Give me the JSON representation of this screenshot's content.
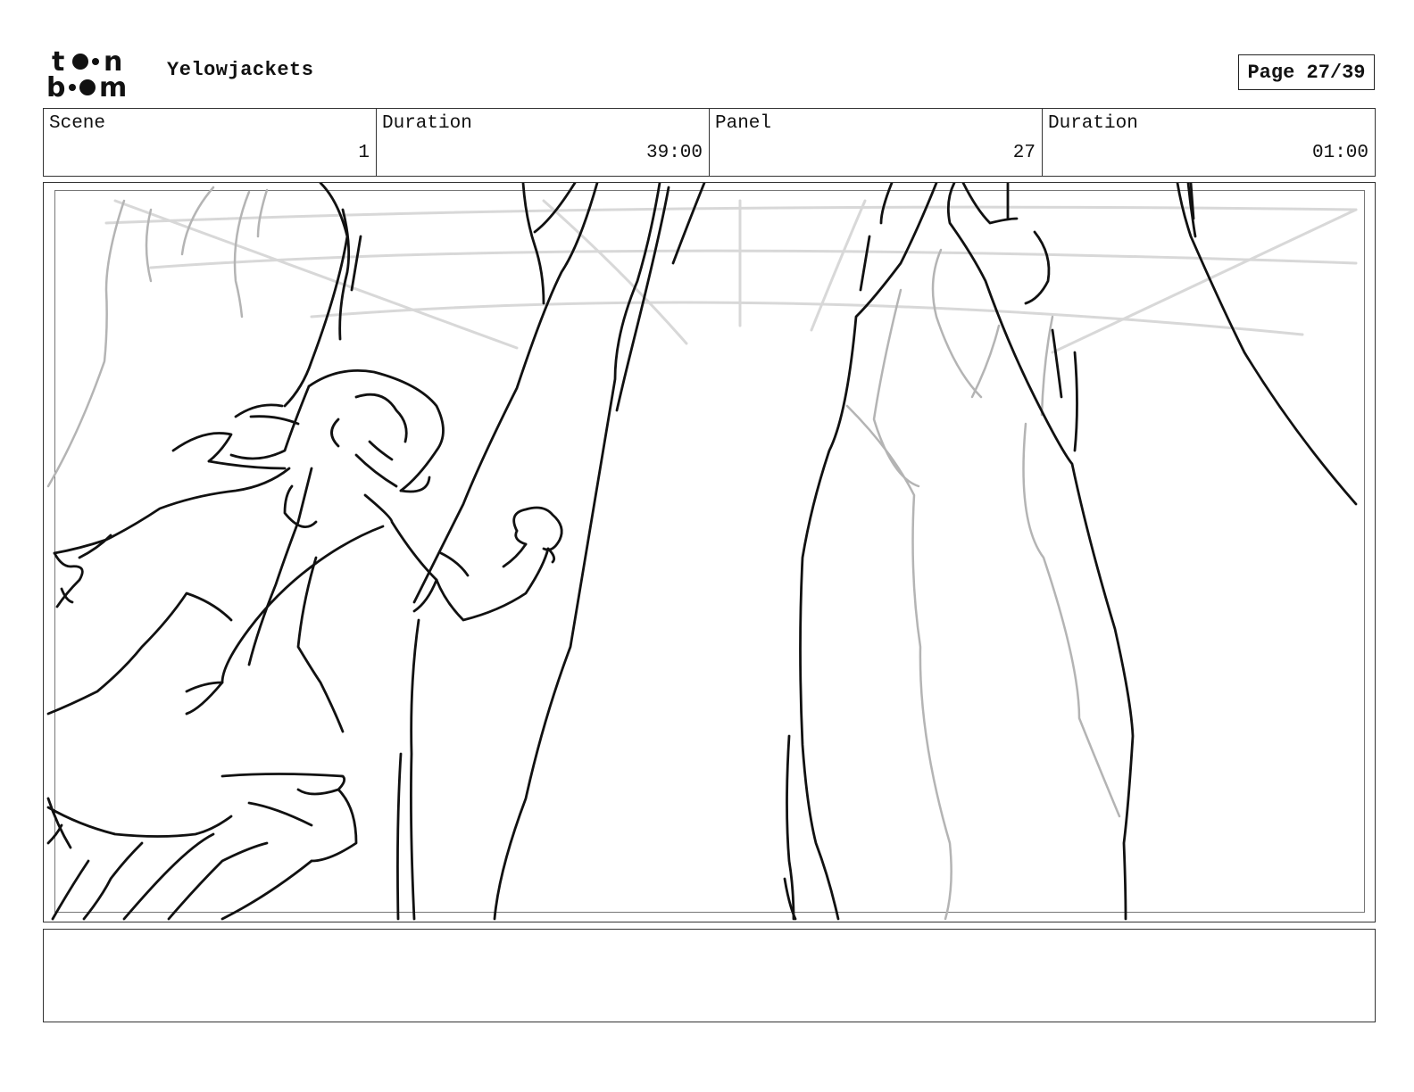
{
  "header": {
    "logo_text": "toonboom",
    "project_title": "Yelowjackets",
    "page_label": "Page 27/39"
  },
  "info": {
    "scene_label": "Scene",
    "scene_value": "1",
    "scene_duration_label": "Duration",
    "scene_duration_value": "39:00",
    "panel_label": "Panel",
    "panel_value": "27",
    "panel_duration_label": "Duration",
    "panel_duration_value": "01:00"
  },
  "notes": {
    "text": ""
  }
}
